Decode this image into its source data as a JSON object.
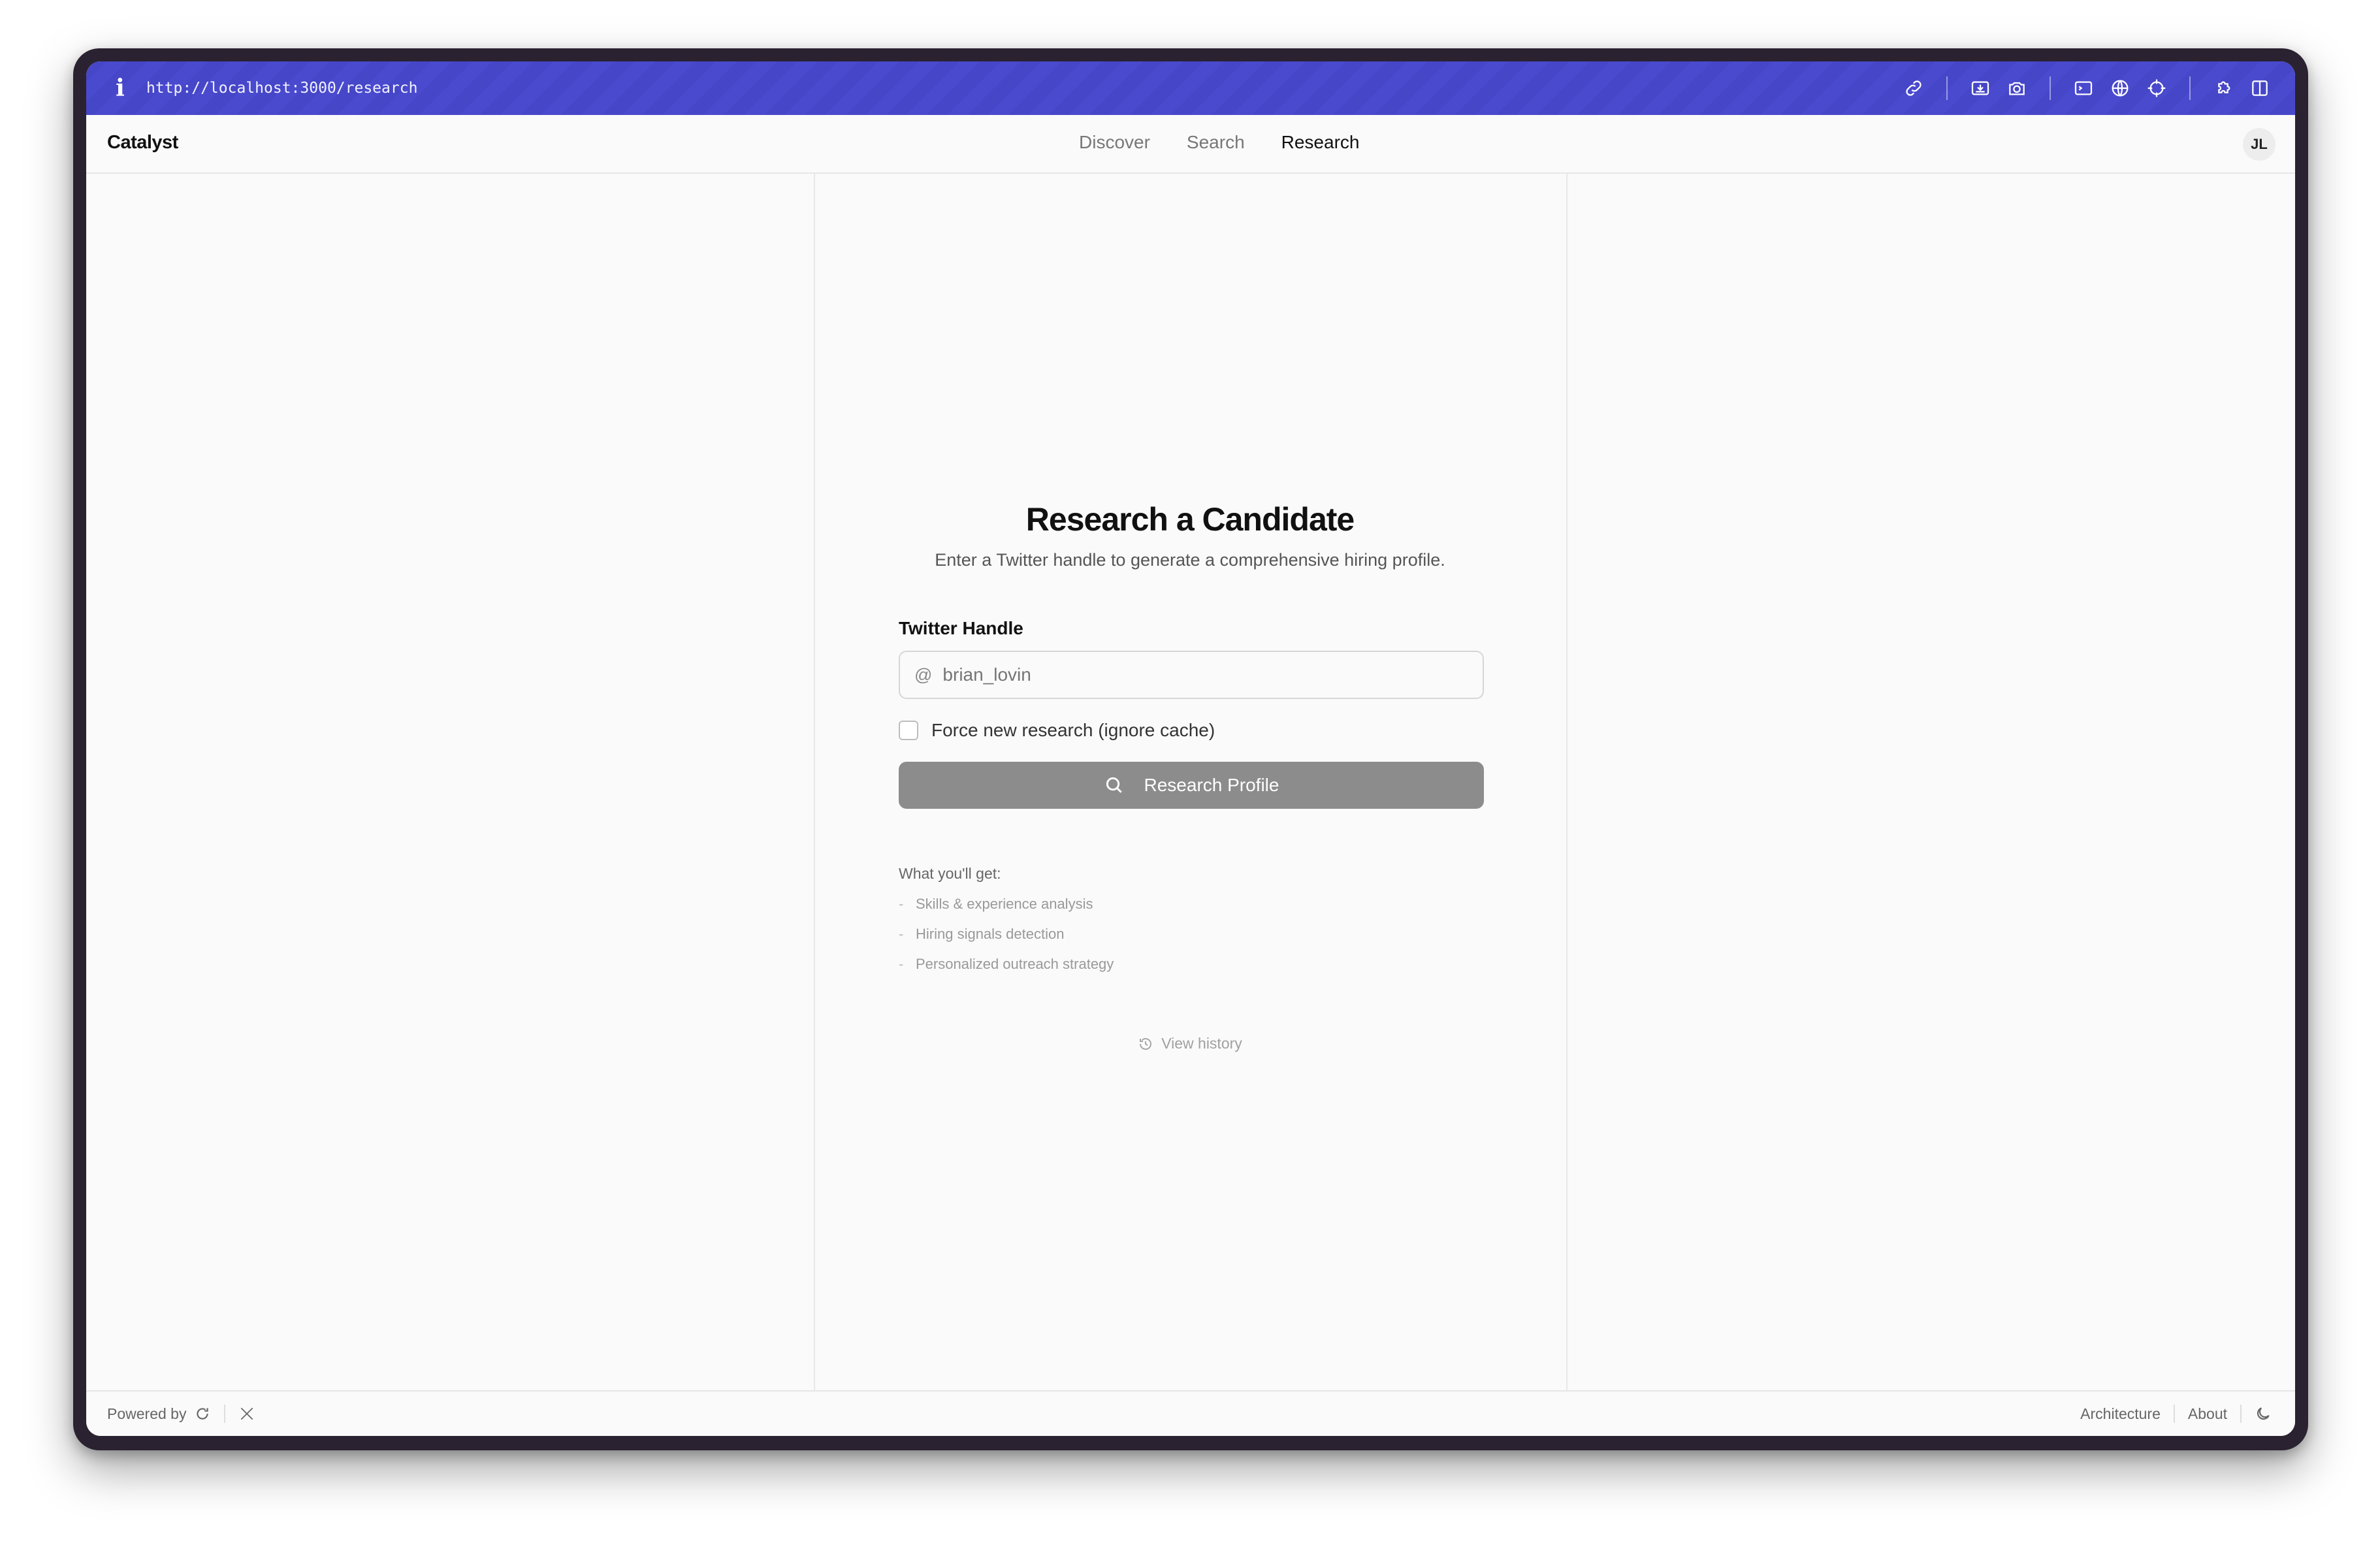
{
  "browser": {
    "info_glyph": "i",
    "url": "http://localhost:3000/research",
    "tools": [
      "link-icon",
      "download-icon",
      "camera-icon",
      "terminal-icon",
      "globe-icon",
      "crosshair-icon",
      "puzzle-icon",
      "split-view-icon"
    ]
  },
  "header": {
    "brand": "Catalyst",
    "nav": [
      {
        "label": "Discover",
        "active": false
      },
      {
        "label": "Search",
        "active": false
      },
      {
        "label": "Research",
        "active": true
      }
    ],
    "avatar": "JL"
  },
  "main": {
    "title": "Research a Candidate",
    "subtitle": "Enter a Twitter handle to generate a comprehensive hiring profile.",
    "field_label": "Twitter Handle",
    "field_prefix": "@",
    "field_placeholder": "brian_lovin",
    "field_value": "",
    "checkbox_label": "Force new research (ignore cache)",
    "checkbox_checked": false,
    "submit_label": "Research Profile",
    "features_title": "What you'll get:",
    "features": [
      "Skills & experience analysis",
      "Hiring signals detection",
      "Personalized outreach strategy"
    ],
    "history_label": "View history"
  },
  "footer": {
    "powered_by": "Powered by",
    "links": [
      "Architecture",
      "About"
    ]
  },
  "colors": {
    "urlbar": "#4646c8",
    "button": "#8c8c8c",
    "background": "#fafafa"
  }
}
